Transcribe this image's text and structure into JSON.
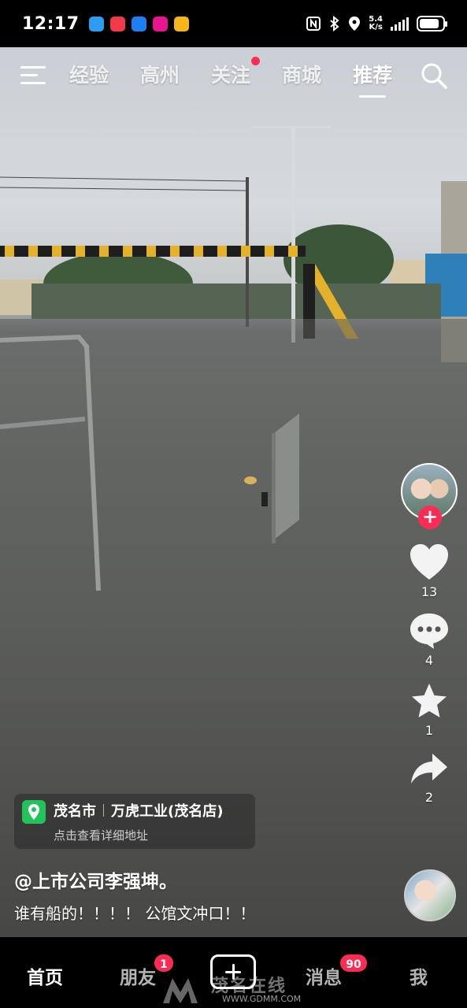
{
  "status_bar": {
    "time": "12:17",
    "net_speed_value": "5.4",
    "net_speed_unit": "K/s",
    "battery_level": 0.85,
    "icons": [
      "nfc-icon",
      "bluetooth-icon",
      "location-icon",
      "signal-icon",
      "battery-icon"
    ]
  },
  "top_nav": {
    "tabs": [
      {
        "label": "经验",
        "active": false
      },
      {
        "label": "高州",
        "active": false
      },
      {
        "label": "关注",
        "active": false,
        "dot": true
      },
      {
        "label": "商城",
        "active": false
      },
      {
        "label": "推荐",
        "active": true
      }
    ]
  },
  "rail": {
    "likes": "13",
    "comments": "4",
    "favorites": "1",
    "shares": "2"
  },
  "location": {
    "city": "茂名市",
    "place": "万虎工业(茂名店)",
    "hint": "点击查看详细地址"
  },
  "post": {
    "author": "@上市公司李强坤。",
    "description": "谁有船的！！！！ 公馆文冲口！！"
  },
  "tab_bar": {
    "home": "首页",
    "friends": "朋友",
    "friends_badge": "1",
    "messages": "消息",
    "messages_badge": "90",
    "me": "我"
  },
  "watermark": {
    "title": "茂名在线",
    "url": "WWW.GDMM.COM"
  },
  "colors": {
    "accent": "#fe2c55",
    "location_green": "#21c35a"
  }
}
